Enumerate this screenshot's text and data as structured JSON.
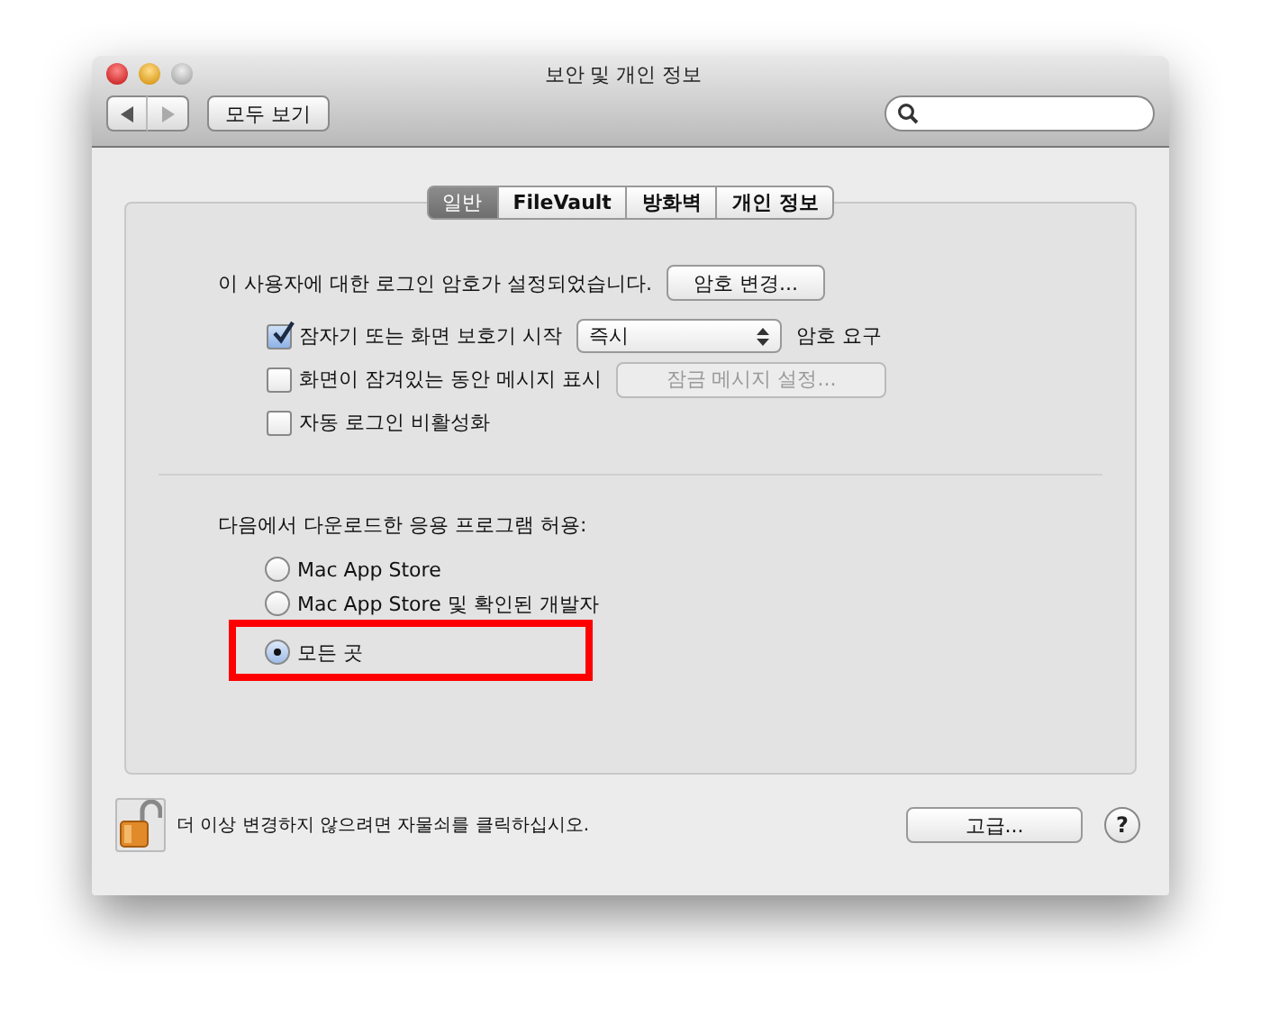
{
  "window": {
    "title": "보안 및 개인 정보"
  },
  "toolbar": {
    "show_all": "모두 보기"
  },
  "tabs": [
    {
      "label": "일반",
      "selected": true
    },
    {
      "label": "FileVault",
      "selected": false
    },
    {
      "label": "방화벽",
      "selected": false
    },
    {
      "label": "개인 정보",
      "selected": false
    }
  ],
  "password": {
    "text": "이 사용자에 대한 로그인 암호가 설정되었습니다.",
    "button": "암호 변경..."
  },
  "options": [
    {
      "kind": "popup",
      "label": "잠자기 또는 화면 보호기 시작",
      "checked": true,
      "value": "즉시",
      "suffix": "암호 요구"
    },
    {
      "kind": "button",
      "label": "화면이 잠겨있는 동안 메시지 표시",
      "checked": false,
      "button": "잠금 메시지 설정...",
      "disabled": true
    },
    {
      "kind": "plain",
      "label": "자동 로그인 비활성화",
      "checked": false
    }
  ],
  "downloads": {
    "heading": "다음에서 다운로드한 응용 프로그램 허용:",
    "choices": [
      {
        "label": "Mac App Store",
        "selected": false,
        "highlighted": false
      },
      {
        "label": "Mac App Store 및 확인된 개발자",
        "selected": false,
        "highlighted": false
      },
      {
        "label": "모든 곳",
        "selected": true,
        "highlighted": true
      }
    ]
  },
  "footer": {
    "lock_text": "더 이상 변경하지 않으려면 자물쇠를 클릭하십시오.",
    "advanced": "고급...",
    "help": "?"
  }
}
